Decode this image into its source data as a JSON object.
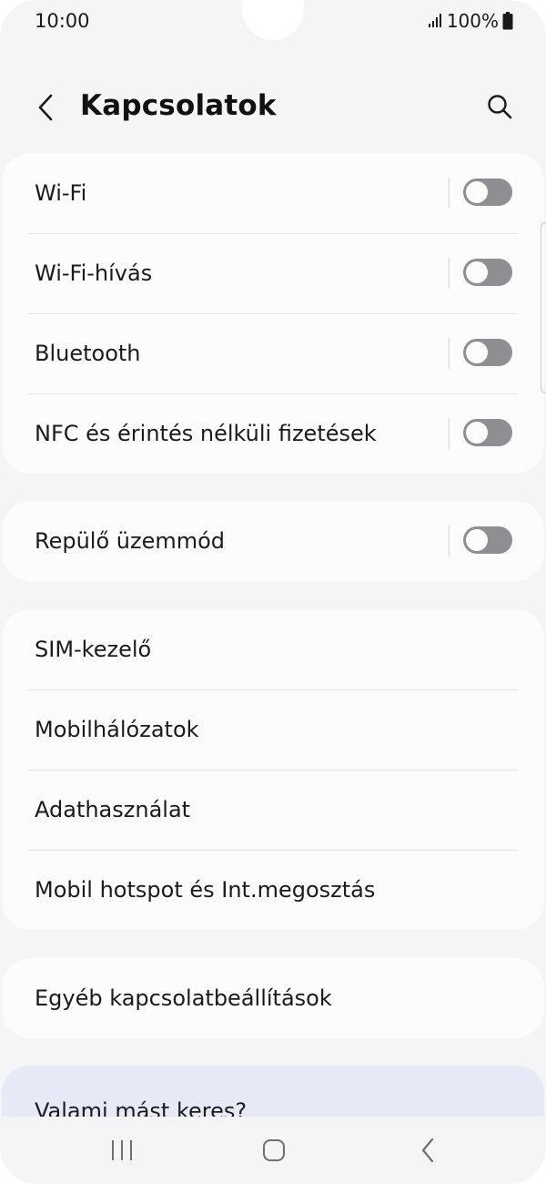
{
  "status_bar": {
    "time": "10:00",
    "battery_percent": "100%",
    "icons": [
      "signal-icon",
      "battery-icon"
    ]
  },
  "header": {
    "title": "Kapcsolatok",
    "icons": [
      "back-arrow-icon",
      "search-icon"
    ]
  },
  "groups": [
    {
      "items": [
        {
          "label": "Wi-Fi",
          "toggle": false
        },
        {
          "label": "Wi-Fi-hívás",
          "toggle": false
        },
        {
          "label": "Bluetooth",
          "toggle": false
        },
        {
          "label": "NFC és érintés nélküli fizetések",
          "toggle": false
        }
      ]
    },
    {
      "items": [
        {
          "label": "Repülő üzemmód",
          "toggle": false
        }
      ]
    },
    {
      "items": [
        {
          "label": "SIM-kezelő"
        },
        {
          "label": "Mobilhálózatok"
        },
        {
          "label": "Adathasználat"
        },
        {
          "label": "Mobil hotspot és Int.megosztás"
        }
      ]
    },
    {
      "items": [
        {
          "label": "Egyéb kapcsolatbeállítások"
        }
      ]
    }
  ],
  "search_suggestion": {
    "title": "Valami mást keres?"
  },
  "nav_bar": {
    "icons": [
      "recent-apps-icon",
      "home-icon",
      "back-icon"
    ]
  },
  "colors": {
    "background": "#f5f5f7",
    "card": "#fcfcfd",
    "switch_off": "#8e8e93",
    "suggestion_card": "#e7eaf6",
    "text": "#1b1b1b"
  }
}
